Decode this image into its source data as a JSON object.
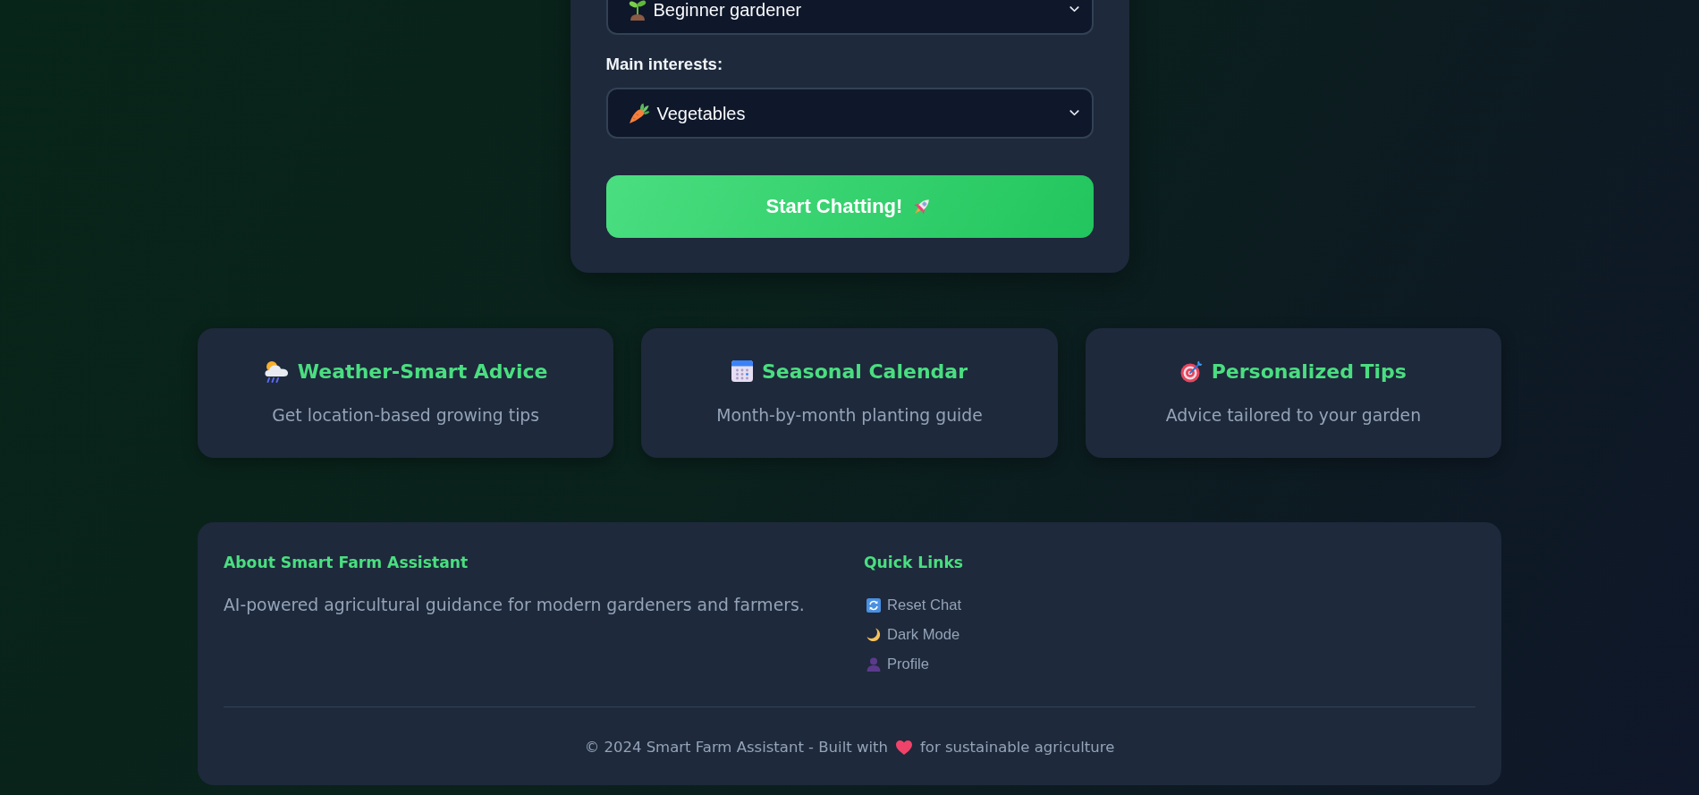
{
  "experience_select": {
    "value": "Beginner gardener"
  },
  "interests_select": {
    "label": "Main interests:",
    "value": "Vegetables"
  },
  "start_button": {
    "label": "Start Chatting!"
  },
  "features": [
    {
      "kind": "weather",
      "title": "Weather-Smart Advice",
      "description": "Get location-based growing tips"
    },
    {
      "kind": "calendar",
      "title": "Seasonal Calendar",
      "description": "Month-by-month planting guide"
    },
    {
      "kind": "tips",
      "title": "Personalized Tips",
      "description": "Advice tailored to your garden"
    }
  ],
  "footer": {
    "about": {
      "title": "About Smart Farm Assistant",
      "text": "AI-powered agricultural guidance for modern gardeners and farmers."
    },
    "quick_links": {
      "title": "Quick Links",
      "links": [
        {
          "kind": "reset",
          "label": "Reset Chat"
        },
        {
          "kind": "theme",
          "label": "Dark Mode"
        },
        {
          "kind": "profile",
          "label": "Profile"
        }
      ]
    },
    "copyright": {
      "text_before_icon": "© 2024 Smart Farm Assistant - Built with",
      "text_after_icon": "for sustainable agriculture"
    }
  }
}
